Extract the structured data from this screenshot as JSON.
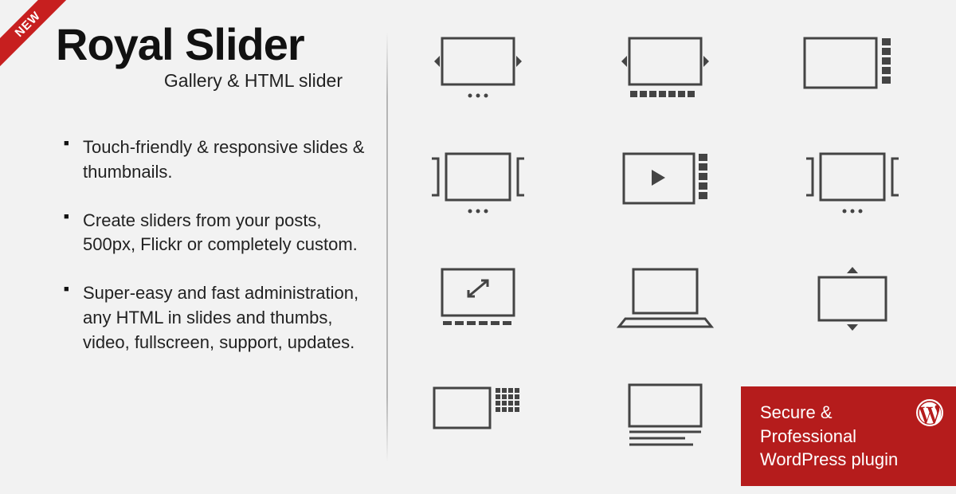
{
  "ribbon": "NEW",
  "title": "Royal Slider",
  "subtitle": "Gallery & HTML slider",
  "features": [
    "Touch-friendly & responsive slides & thumbnails.",
    "Create sliders from your posts, 500px, Flickr or completely custom.",
    "Super-easy and fast administration, any HTML in slides and thumbs, video, fullscreen, support, updates."
  ],
  "badge": {
    "line1": "Secure &",
    "line2": "Professional",
    "line3": "WordPress plugin"
  }
}
